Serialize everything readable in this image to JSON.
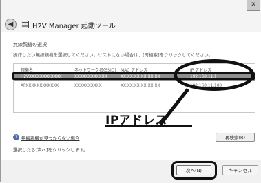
{
  "window": {
    "title": "H2V Manager 起動ツール",
    "close_glyph": "✕",
    "back_glyph": "◀"
  },
  "main": {
    "section_title": "無線親機の選択",
    "instruction": "操作したい無線親機を選択してください。リストにない場合は、[再検索]をクリックしてください。",
    "table": {
      "columns": [
        "親機名",
        "ネットワーク名(SSID)",
        "MAC アドレス",
        "IP アドレス"
      ],
      "rows": [
        {
          "name": "H2VXXXXXXXXXXXX",
          "ssid": "XXXXXXXXXXXX",
          "mac": "XX:XX:XX:XX:XX:XX",
          "ip": "192.168.11.1",
          "selected": true
        },
        {
          "name": "APXXXXXXXXXXXX",
          "ssid": "XXXXXXXXXX",
          "mac": "XX:XX:XX:XX:XX:XX",
          "ip": "192.168.11.100",
          "selected": false
        }
      ]
    },
    "annotation": "IPアドレス",
    "help_link": "無線親機が見つからない場合",
    "rescan_label": "再検索(R)",
    "bottom_note": "選択したら[次へ]をクリックします。"
  },
  "footer": {
    "next_label": "次へ(N)",
    "cancel_label": "キャンセル"
  },
  "colors": {
    "selected_row": "#8f8f8f",
    "annotation": "#111111",
    "help_icon": "#4a6ea8"
  }
}
